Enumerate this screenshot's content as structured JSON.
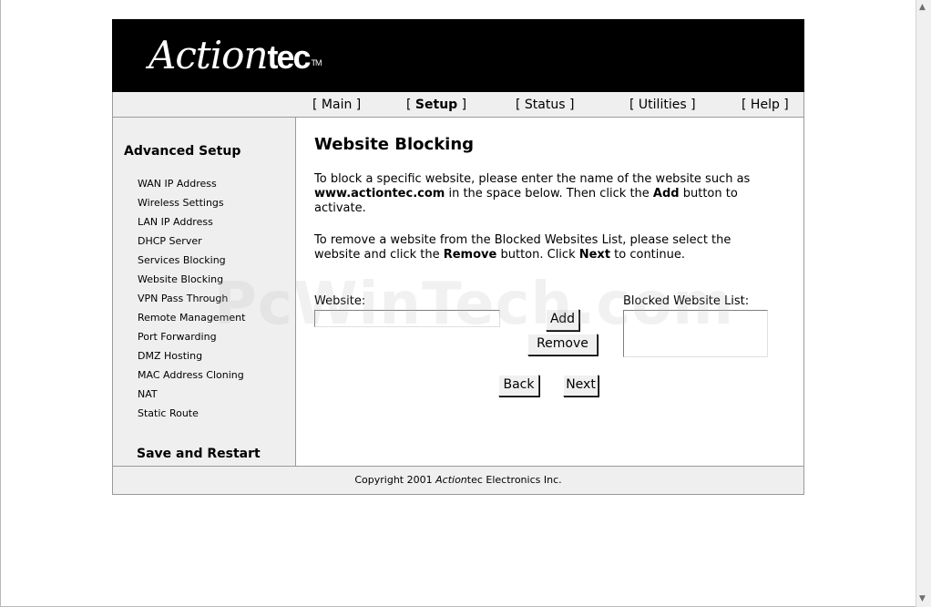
{
  "header": {
    "logo_script": "Action",
    "logo_tec": "tec",
    "logo_tm": "TM"
  },
  "nav": {
    "items": [
      {
        "label": "Main"
      },
      {
        "label": "Setup"
      },
      {
        "label": "Status"
      },
      {
        "label": "Utilities"
      },
      {
        "label": "Help"
      }
    ],
    "active": "Setup"
  },
  "sidebar": {
    "title": "Advanced Setup",
    "items": [
      {
        "label": "WAN IP Address"
      },
      {
        "label": "Wireless Settings"
      },
      {
        "label": "LAN IP Address"
      },
      {
        "label": "DHCP Server"
      },
      {
        "label": "Services Blocking"
      },
      {
        "label": "Website Blocking"
      },
      {
        "label": "VPN Pass Through"
      },
      {
        "label": "Remote Management"
      },
      {
        "label": "Port Forwarding"
      },
      {
        "label": "DMZ Hosting"
      },
      {
        "label": "MAC Address Cloning"
      },
      {
        "label": "NAT"
      },
      {
        "label": "Static Route"
      }
    ],
    "save_label": "Save and Restart"
  },
  "content": {
    "title": "Website Blocking",
    "para1": {
      "a": "To block a specific website, please enter the name of the website such as ",
      "b": "www.actiontec.com",
      "c": " in the space below. Then click the ",
      "d": "Add",
      "e": " button to activate."
    },
    "para2": {
      "a": "To remove a website from the Blocked Websites List, please select the website and click the ",
      "b": "Remove",
      "c": " button. Click ",
      "d": "Next",
      "e": " to continue."
    },
    "website_label": "Website:",
    "website_value": "",
    "blocked_label": "Blocked Website List:",
    "add_label": "Add",
    "remove_label": "Remove",
    "back_label": "Back",
    "next_label": "Next"
  },
  "footer": {
    "pre": "Copyright 2001 ",
    "brand_italic": "Action",
    "brand_rest": "tec Electronics Inc."
  },
  "watermark": "PcWinTech.com"
}
